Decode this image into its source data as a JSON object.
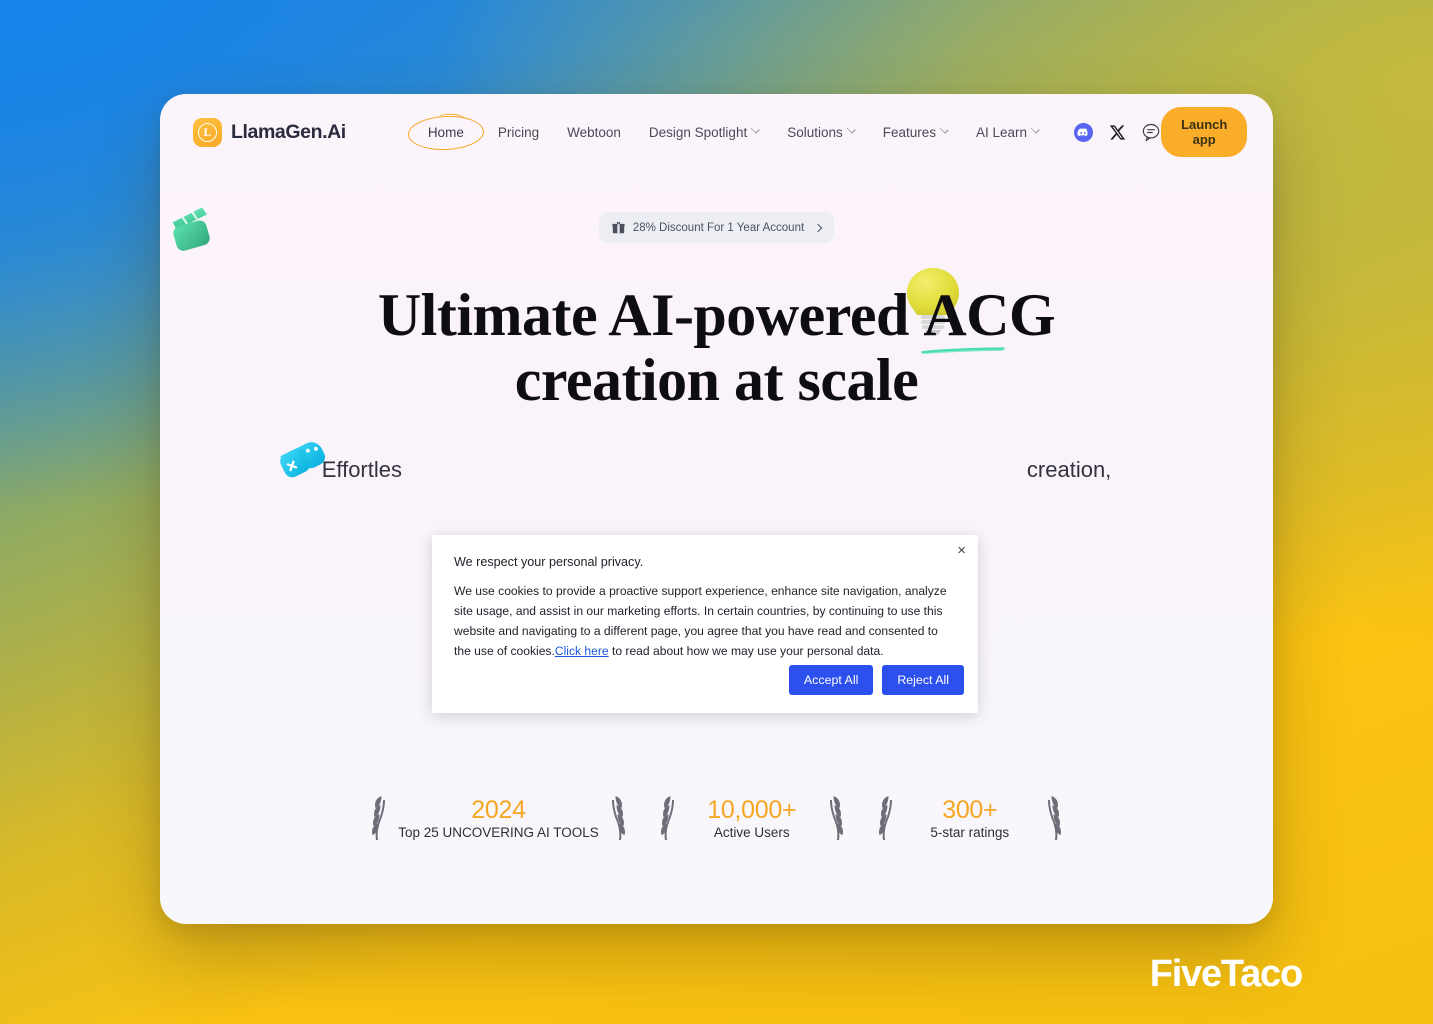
{
  "brand": {
    "mark_letter": "L",
    "name": "LlamaGen.Ai"
  },
  "nav": {
    "items": [
      {
        "label": "Home",
        "has_caret": false,
        "active": true
      },
      {
        "label": "Pricing",
        "has_caret": false,
        "active": false
      },
      {
        "label": "Webtoon",
        "has_caret": false,
        "active": false
      },
      {
        "label": "Design Spotlight",
        "has_caret": true,
        "active": false
      },
      {
        "label": "Solutions",
        "has_caret": true,
        "active": false
      },
      {
        "label": "Features",
        "has_caret": true,
        "active": false
      },
      {
        "label": "AI Learn",
        "has_caret": true,
        "active": false
      }
    ],
    "social": [
      {
        "icon": "discord-icon"
      },
      {
        "icon": "x-twitter-icon"
      },
      {
        "icon": "chat-bubble-icon"
      }
    ],
    "launch_app_label": "Launch app"
  },
  "hero": {
    "discount": {
      "icon": "gift-icon",
      "text": "28% Discount For 1 Year Account",
      "chevron": "chevron-right-icon"
    },
    "title_line1_pre": "Ultimate AI-powered ",
    "title_line1_underlined": "ACG",
    "title_line2": "creation at scale",
    "subtitle_visible_left": "Effortles",
    "subtitle_visible_right": "creation,"
  },
  "stats": [
    {
      "value": "2024",
      "label": "Top 25 UNCOVERING AI TOOLS"
    },
    {
      "value": "10,000+",
      "label": "Active Users"
    },
    {
      "value": "300+",
      "label": "5-star ratings"
    }
  ],
  "cookie_dialog": {
    "close_label": "×",
    "heading": "We respect your personal privacy.",
    "body_before_link": "We use cookies to provide a proactive support experience, enhance site navigation, analyze site usage, and assist in our marketing efforts. In certain countries, by continuing to use this website and navigating to a different page, you agree that you have read and consented to the use of cookies.",
    "link_text": "Click here",
    "body_after_link": " to read about how we may use your personal data.",
    "accept_label": "Accept All",
    "reject_label": "Reject All"
  },
  "decorations": [
    {
      "name": "clapperboard-emoji",
      "color": "#3fc79a"
    },
    {
      "name": "game-controller-emoji",
      "color": "#2dc7ed"
    },
    {
      "name": "lightbulb-emoji",
      "color": "#e3e040"
    }
  ],
  "watermark": {
    "text": "FiveTaco"
  },
  "colors": {
    "brand_orange": "#f9ad28",
    "accent_orange": "#f5a623",
    "dialog_blue": "#2b50ed",
    "link_blue": "#1a56db",
    "underline_green": "#4bdcae",
    "card_bg": "#fbf4fa",
    "bg_blue": "#1684ea",
    "bg_yellow": "#fbc312"
  }
}
